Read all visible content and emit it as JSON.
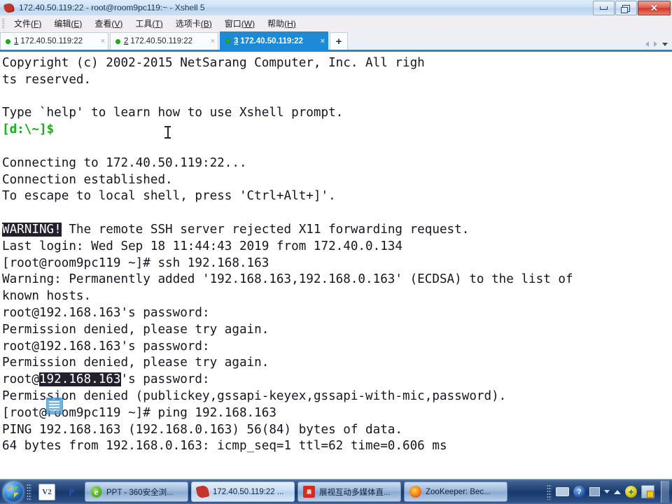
{
  "window": {
    "title": "172.40.50.119:22 - root@room9pc119:~ - Xshell 5",
    "app_icon": "xshell-icon",
    "controls": {
      "minimize": "minimize-button",
      "maximize": "maximize-button",
      "close": "✕"
    }
  },
  "menubar": {
    "items": [
      {
        "label": "文件",
        "mnemonic": "(F)"
      },
      {
        "label": "编辑",
        "mnemonic": "(E)"
      },
      {
        "label": "查看",
        "mnemonic": "(V)"
      },
      {
        "label": "工具",
        "mnemonic": "(T)"
      },
      {
        "label": "选项卡",
        "mnemonic": "(B)"
      },
      {
        "label": "窗口",
        "mnemonic": "(W)"
      },
      {
        "label": "帮助",
        "mnemonic": "(H)"
      }
    ]
  },
  "tabbar": {
    "tabs": [
      {
        "number": "1",
        "label": "172.40.50.119:22",
        "active": false,
        "close": "×",
        "status": "connected"
      },
      {
        "number": "2",
        "label": "172.40.50.119:22",
        "active": false,
        "close": "×",
        "status": "connected"
      },
      {
        "number": "3",
        "label": "172.40.50.119:22",
        "active": true,
        "close": "×",
        "status": "connected"
      }
    ],
    "new_tab_label": "+",
    "nav": {
      "prev": "◀",
      "next": "▶",
      "list": "▾"
    }
  },
  "terminal": {
    "colors": {
      "background": "#ffffff",
      "foreground": "#181420",
      "prompt_green": "#12b312",
      "inverse_background": "#231f2c",
      "inverse_foreground": "#ffffff"
    },
    "lines": [
      {
        "text": "Copyright (c) 2002-2015 NetSarang Computer, Inc. All righ"
      },
      {
        "text": "ts reserved."
      },
      {
        "text": ""
      },
      {
        "text": "Type `help' to learn how to use Xshell prompt."
      },
      {
        "text": "[d:\\~]$",
        "style": "green"
      },
      {
        "text": ""
      },
      {
        "text": "Connecting to 172.40.50.119:22..."
      },
      {
        "text": "Connection established."
      },
      {
        "text": "To escape to local shell, press 'Ctrl+Alt+]'."
      },
      {
        "text": ""
      },
      {
        "text": "WARNING! The remote SSH server rejected X11 forwarding request.",
        "inverse_span": "WARNING!"
      },
      {
        "text": "Last login: Wed Sep 18 11:44:43 2019 from 172.40.0.134"
      },
      {
        "text": "[root@room9pc119 ~]# ssh 192.168.163"
      },
      {
        "text": "Warning: Permanently added '192.168.163,192.168.0.163' (ECDSA) to the list of"
      },
      {
        "text": "known hosts."
      },
      {
        "text": "root@192.168.163's password:"
      },
      {
        "text": "Permission denied, please try again."
      },
      {
        "text": "root@192.168.163's password:"
      },
      {
        "text": "Permission denied, please try again."
      },
      {
        "text": "root@192.168.163's password:",
        "inverse_span": "192.168.163"
      },
      {
        "text": "Permission denied (publickey,gssapi-keyex,gssapi-with-mic,password)."
      },
      {
        "text": "[root@room9pc119 ~]# ping 192.168.163"
      },
      {
        "text": "PING 192.168.163 (192.168.0.163) 56(84) bytes of data."
      },
      {
        "text": "64 bytes from 192.168.0.163: icmp_seq=1 ttl=62 time=0.606 ms"
      },
      {
        "text": ""
      },
      {
        "text": "",
        "cursor": true
      }
    ]
  },
  "taskbar": {
    "start_label": "start-orb",
    "quicklaunch": [
      {
        "name": "v2-icon",
        "label": "V2"
      },
      {
        "name": "p-icon",
        "label": "P"
      }
    ],
    "buttons": [
      {
        "label": "PPT - 360安全浏...",
        "icon": "browser-icon",
        "pressed": false
      },
      {
        "label": "172.40.50.119:22 ...",
        "icon": "xshell-icon",
        "pressed": true
      },
      {
        "label": "展视互动多媒体直...",
        "icon": "media-icon",
        "pressed": false
      },
      {
        "label": "ZooKeeper: Bec...",
        "icon": "firefox-icon",
        "pressed": false
      }
    ],
    "tray": [
      {
        "name": "keyboard-ime-icon"
      },
      {
        "name": "help-icon",
        "label": "?"
      },
      {
        "name": "network-icon"
      },
      {
        "name": "show-hidden-icons-icon"
      },
      {
        "name": "security-shield-icon"
      },
      {
        "name": "action-center-icon"
      }
    ]
  }
}
